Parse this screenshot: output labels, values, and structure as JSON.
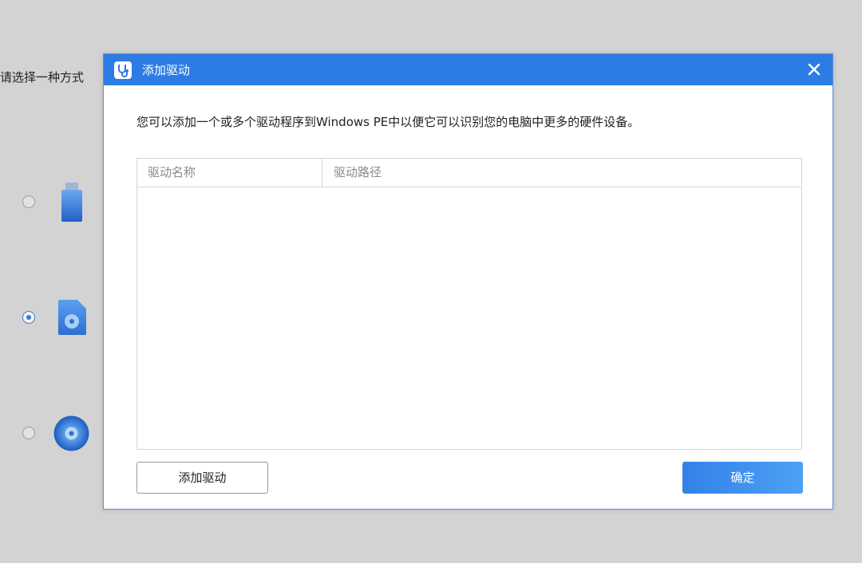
{
  "background": {
    "prompt": "请选择一种方式",
    "options": [
      {
        "icon": "usb-drive-icon",
        "selected": false
      },
      {
        "icon": "iso-file-icon",
        "selected": true
      },
      {
        "icon": "cd-disc-icon",
        "selected": false
      }
    ]
  },
  "dialog": {
    "title": "添加驱动",
    "title_icon": "stethoscope-app-logo-icon",
    "close_icon": "close-icon",
    "description": "您可以添加一个或多个驱动程序到Windows PE中以便它可以识别您的电脑中更多的硬件设备。",
    "table": {
      "columns": [
        "驱动名称",
        "驱动路径"
      ],
      "rows": []
    },
    "add_button": "添加驱动",
    "ok_button": "确定"
  },
  "colors": {
    "titlebar": "#2d7be5",
    "accent": "#3381e8",
    "background": "#d3d3d3"
  }
}
